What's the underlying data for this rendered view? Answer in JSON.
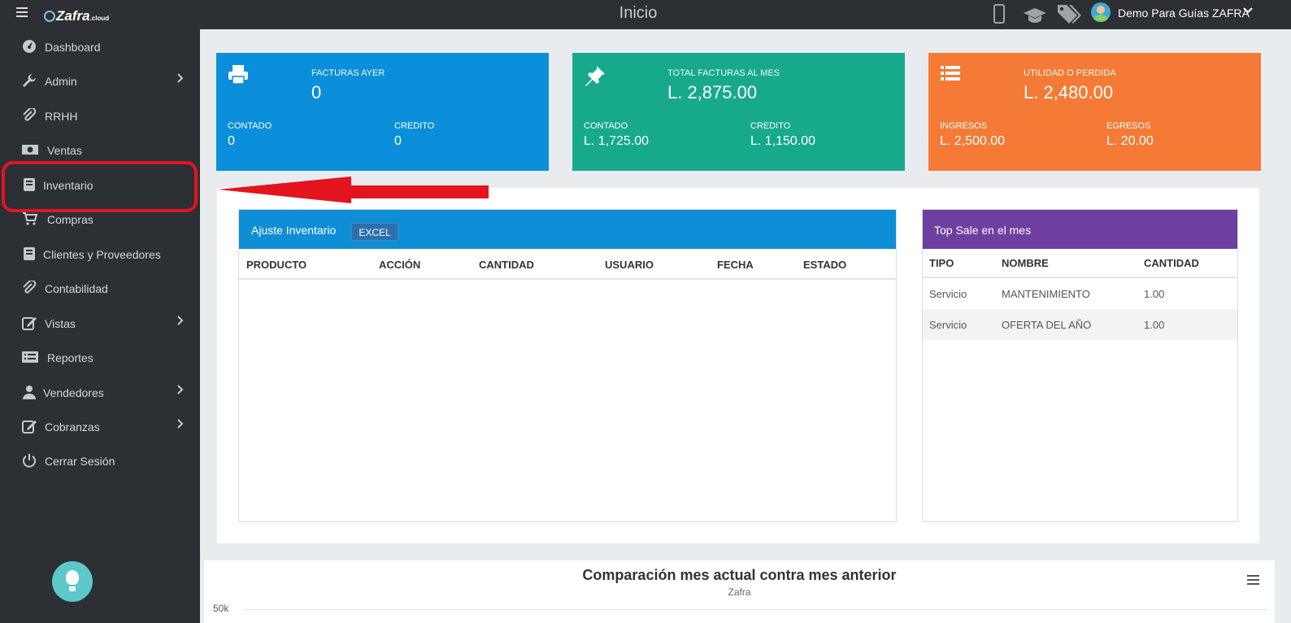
{
  "header": {
    "logo_text": "Zafra",
    "logo_suffix": ".cloud",
    "page_title": "Inicio",
    "user_name": "Demo Para Guías ZAFRA",
    "icons": [
      "menu-icon",
      "phone-icon",
      "graduation-cap-icon",
      "tags-icon",
      "user-avatar",
      "chevron-down-icon"
    ]
  },
  "sidebar": {
    "items": [
      {
        "label": "Dashboard",
        "icon": "dashboard-icon",
        "has_submenu": false
      },
      {
        "label": "Admin",
        "icon": "wrench-icon",
        "has_submenu": true
      },
      {
        "label": "RRHH",
        "icon": "paperclip-icon",
        "has_submenu": false
      },
      {
        "label": "Ventas",
        "icon": "money-icon",
        "has_submenu": false
      },
      {
        "label": "Inventario",
        "icon": "book-icon",
        "has_submenu": false
      },
      {
        "label": "Compras",
        "icon": "cart-icon",
        "has_submenu": false
      },
      {
        "label": "Clientes y Proveedores",
        "icon": "book-icon",
        "has_submenu": false
      },
      {
        "label": "Contabilidad",
        "icon": "paperclip-icon",
        "has_submenu": false
      },
      {
        "label": "Vistas",
        "icon": "edit-icon",
        "has_submenu": true
      },
      {
        "label": "Reportes",
        "icon": "list-icon",
        "has_submenu": false
      },
      {
        "label": "Vendedores",
        "icon": "user-icon",
        "has_submenu": true
      },
      {
        "label": "Cobranzas",
        "icon": "edit-icon",
        "has_submenu": true
      },
      {
        "label": "Cerrar Sesión",
        "icon": "power-icon",
        "has_submenu": false
      }
    ],
    "highlighted_item": "Inventario",
    "bulb_icon": "lightbulb-icon"
  },
  "cards": [
    {
      "title": "FACTURAS AYER",
      "value": "0",
      "left_label": "CONTADO",
      "left_value": "0",
      "right_label": "CREDITO",
      "right_value": "0",
      "color": "#0b8fdb",
      "icon": "printer-icon"
    },
    {
      "title": "TOTAL FACTURAS AL MES",
      "value": "L. 2,875.00",
      "left_label": "CONTADO",
      "left_value": "L. 1,725.00",
      "right_label": "CREDITO",
      "right_value": "L. 1,150.00",
      "color": "#17a98b",
      "icon": "pin-icon"
    },
    {
      "title": "UTILIDAD O PERDIDA",
      "value": "L. 2,480.00",
      "left_label": "INGRESOS",
      "left_value": "L. 2,500.00",
      "right_label": "EGRESOS",
      "right_value": "L. 20.00",
      "color": "#f47a36",
      "icon": "list-icon"
    }
  ],
  "ajuste": {
    "title": "Ajuste Inventario",
    "excel_label": "EXCEL",
    "columns": [
      "PRODUCTO",
      "ACCIÓN",
      "CANTIDAD",
      "USUARIO",
      "FECHA",
      "ESTADO"
    ],
    "rows": []
  },
  "top_sale": {
    "title": "Top Sale en el mes",
    "columns": [
      "TIPO",
      "NOMBRE",
      "CANTIDAD"
    ],
    "rows": [
      {
        "tipo": "Servicio",
        "nombre": "MANTENIMIENTO",
        "cantidad": "1.00"
      },
      {
        "tipo": "Servicio",
        "nombre": "OFERTA DEL AÑO",
        "cantidad": "1.00"
      }
    ]
  },
  "chart": {
    "title": "Comparación mes actual contra mes anterior",
    "subtitle": "Zafra",
    "top_tick": "50k",
    "menu_icon": "hamburger-icon"
  },
  "colors": {
    "topbar": "#2c2f33",
    "annotation": "#e4141f",
    "ajuste_header": "#0f8ed8",
    "top_sale_header": "#6c3fa0"
  }
}
